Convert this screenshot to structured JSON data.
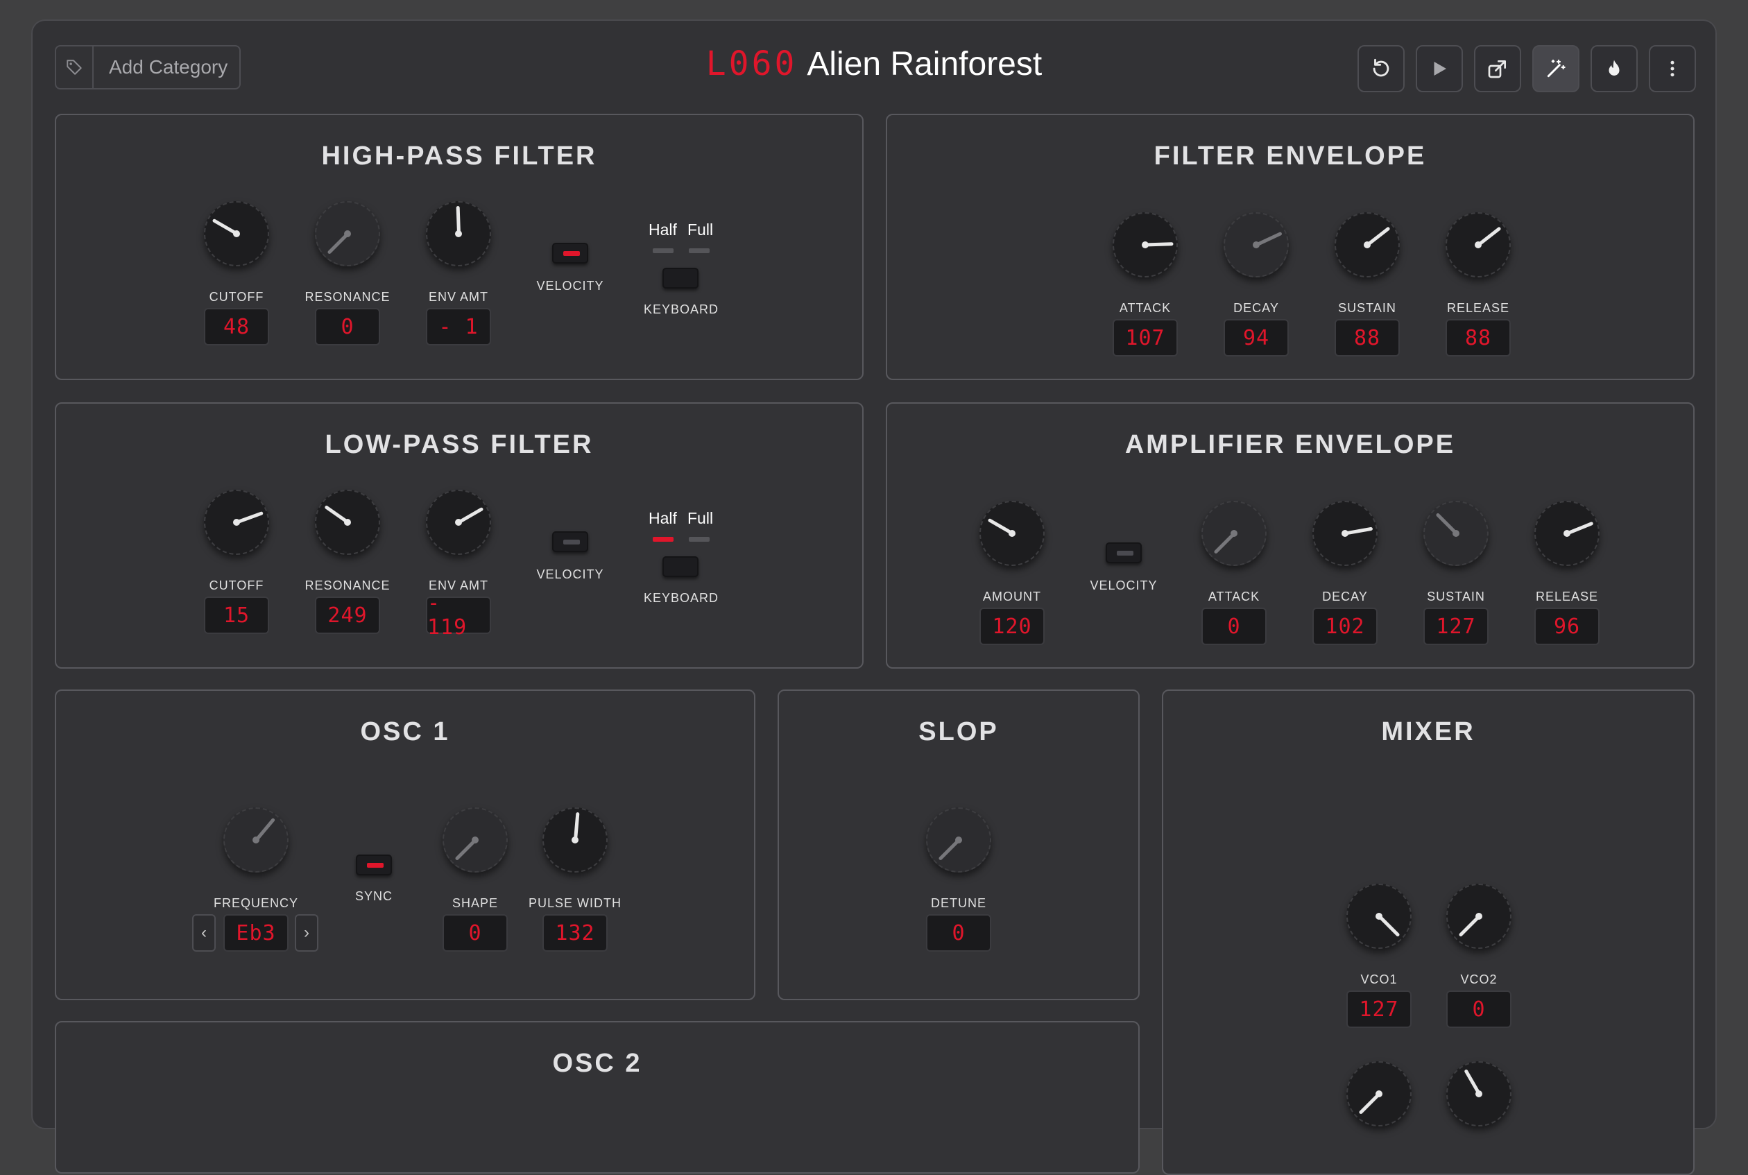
{
  "header": {
    "add_category": "Add Category",
    "preset_code": "L060",
    "preset_name": "Alien Rainforest",
    "buttons": [
      "undo-icon",
      "play-icon",
      "share-icon",
      "magic-wand-icon",
      "flame-icon",
      "more-vert-icon"
    ]
  },
  "hpf": {
    "title": "HIGH-PASS FILTER",
    "cutoff_label": "CUTOFF",
    "cutoff_value": "48",
    "resonance_label": "RESONANCE",
    "resonance_value": "0",
    "envamt_label": "ENV AMT",
    "envamt_value": "- 1",
    "velocity_label": "VELOCITY",
    "velocity_on": true,
    "half_label": "Half",
    "full_label": "Full",
    "keyboard_label": "KEYBOARD"
  },
  "fenv": {
    "title": "FILTER ENVELOPE",
    "attack_label": "ATTACK",
    "attack_value": "107",
    "decay_label": "DECAY",
    "decay_value": "94",
    "sustain_label": "SUSTAIN",
    "sustain_value": "88",
    "release_label": "RELEASE",
    "release_value": "88"
  },
  "lpf": {
    "title": "LOW-PASS FILTER",
    "cutoff_label": "CUTOFF",
    "cutoff_value": "15",
    "resonance_label": "RESONANCE",
    "resonance_value": "249",
    "envamt_label": "ENV AMT",
    "envamt_value": "- 119",
    "velocity_label": "VELOCITY",
    "velocity_on": false,
    "half_label": "Half",
    "full_label": "Full",
    "half_on": true,
    "keyboard_label": "KEYBOARD"
  },
  "aenv": {
    "title": "AMPLIFIER ENVELOPE",
    "amount_label": "AMOUNT",
    "amount_value": "120",
    "velocity_label": "VELOCITY",
    "attack_label": "ATTACK",
    "attack_value": "0",
    "decay_label": "DECAY",
    "decay_value": "102",
    "sustain_label": "SUSTAIN",
    "sustain_value": "127",
    "release_label": "RELEASE",
    "release_value": "96"
  },
  "osc1": {
    "title": "OSC 1",
    "frequency_label": "FREQUENCY",
    "frequency_value": "Eb3",
    "sync_label": "SYNC",
    "sync_on": true,
    "shape_label": "SHAPE",
    "shape_value": "0",
    "pw_label": "PULSE WIDTH",
    "pw_value": "132"
  },
  "slop": {
    "title": "SLOP",
    "detune_label": "DETUNE",
    "detune_value": "0"
  },
  "mixer": {
    "title": "MIXER",
    "vco1_label": "VCO1",
    "vco1_value": "127",
    "vco2_label": "VCO2",
    "vco2_value": "0"
  },
  "osc2": {
    "title": "OSC 2"
  },
  "colors": {
    "accent": "#e0162b",
    "panel": "#333336",
    "background": "#404041"
  }
}
